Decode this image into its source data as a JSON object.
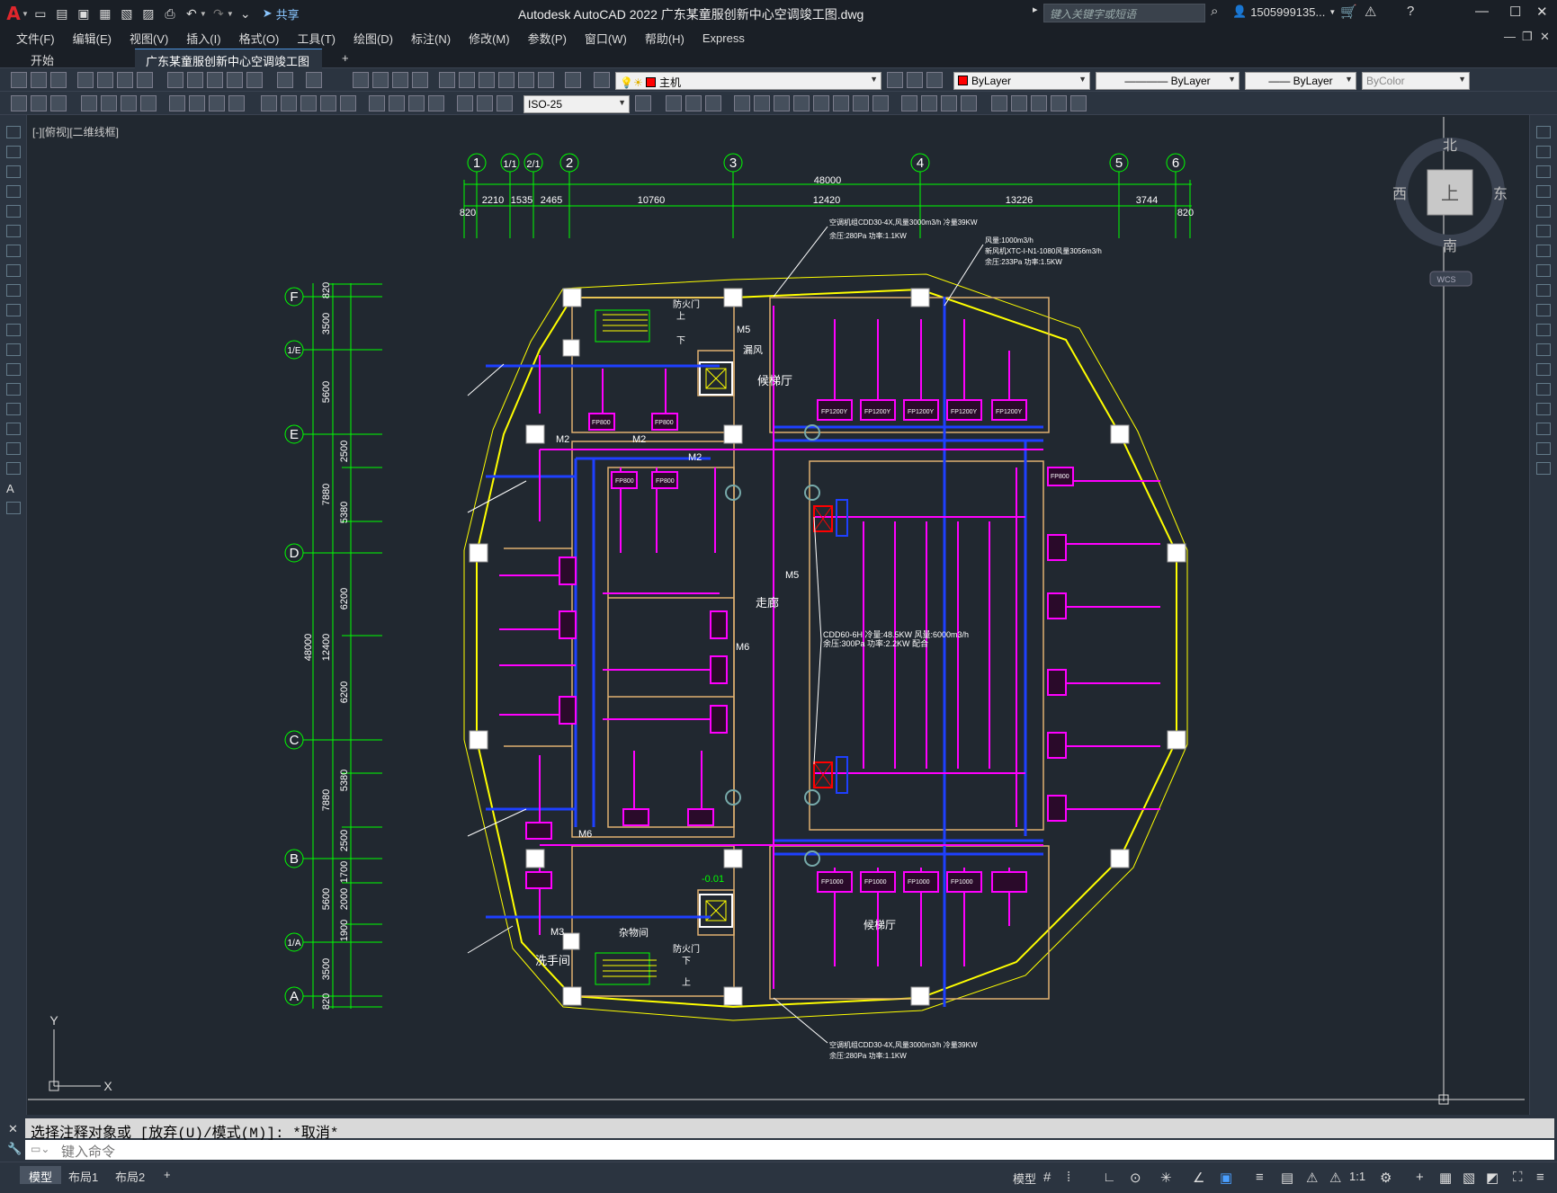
{
  "app": {
    "title": "Autodesk AutoCAD 2022    广东某童服创新中心空调竣工图.dwg",
    "share_label": "共享",
    "search_placeholder": "键入关键字或短语",
    "user": "1505999135..."
  },
  "menu": [
    "文件(F)",
    "编辑(E)",
    "视图(V)",
    "插入(I)",
    "格式(O)",
    "工具(T)",
    "绘图(D)",
    "标注(N)",
    "修改(M)",
    "参数(P)",
    "窗口(W)",
    "帮助(H)",
    "Express"
  ],
  "tabs": {
    "start": "开始",
    "drawing": "广东某童服创新中心空调竣工图*",
    "close": "✕",
    "add": "+"
  },
  "toolbar": {
    "layer": "主机",
    "color": "ByLayer",
    "linetype": "ByLayer",
    "lineweight": "ByLayer",
    "plotstyle": "ByColor",
    "dimstyle": "ISO-25"
  },
  "viewport": {
    "label": "[-][俯视][二维线框]"
  },
  "viewcube": {
    "north": "北",
    "south": "南",
    "east": "东",
    "west": "西",
    "top": "上",
    "wcs": "WCS"
  },
  "ucs": {
    "x": "X",
    "y": "Y"
  },
  "grid_cols": [
    "1",
    "1/1",
    "2/1",
    "2",
    "3",
    "4",
    "5",
    "6"
  ],
  "grid_rows": [
    "F",
    "1/E",
    "E",
    "D",
    "C",
    "B",
    "1/A",
    "A"
  ],
  "dims_top": {
    "total": "48000",
    "segments": [
      "2210",
      "1535",
      "2465",
      "10760",
      "12420",
      "13226",
      "3744"
    ],
    "ends": [
      "820",
      "820"
    ]
  },
  "dims_left": {
    "outer": [
      "820",
      "3500",
      "5600",
      "2500",
      "5380",
      "6200",
      "6200",
      "5380",
      "2500",
      "5600",
      "1900",
      "3500",
      "820"
    ],
    "mid": [
      "7880",
      "12400",
      "7880",
      "2000",
      "1700"
    ],
    "total": "48000"
  },
  "rooms": {
    "corridor": "走廊",
    "lobby": "候梯厅",
    "wash": "洗手间",
    "storage": "杂物间",
    "elevator_room": "候梯厅",
    "leak": "漏风",
    "fire_door": "防火门",
    "up": "上",
    "down": "下",
    "level": "-0.01"
  },
  "equip_notes": [
    "空调机组CDD30-4X,风量3000m3/h 冷量39KW",
    "余压:280Pa 功率:1.1KW",
    "CDD60-6H 冷量:48.5KW 风量:6000m3/h",
    "余压:300Pa 功率:2.2KW 配合",
    "风量:1000m3/h",
    "新风机XTC-I-N1-1080风量3056m3/h",
    "余压:233Pa 功率:1.5KW",
    "空调机组CDD30-4X,风量3000m3/h 冷量39KW",
    "余压:280Pa 功率:1.1KW"
  ],
  "fcu": [
    "FP1200Y",
    "FP1200Y",
    "FP1200Y",
    "FP1200Y",
    "FP1200Y",
    "FP800",
    "FP800",
    "FP800",
    "FP800",
    "FP800",
    "FP1000",
    "FP1000",
    "FP1000",
    "FP1000",
    "M2",
    "M2",
    "M2",
    "M5",
    "M5",
    "M6",
    "M6",
    "M3"
  ],
  "command": {
    "history": "选择注释对象或 [放弃(U)/模式(M)]: *取消*",
    "placeholder": "键入命令"
  },
  "layouts": [
    "模型",
    "布局1",
    "布局2"
  ],
  "status": {
    "model": "模型",
    "scale": "1:1"
  }
}
